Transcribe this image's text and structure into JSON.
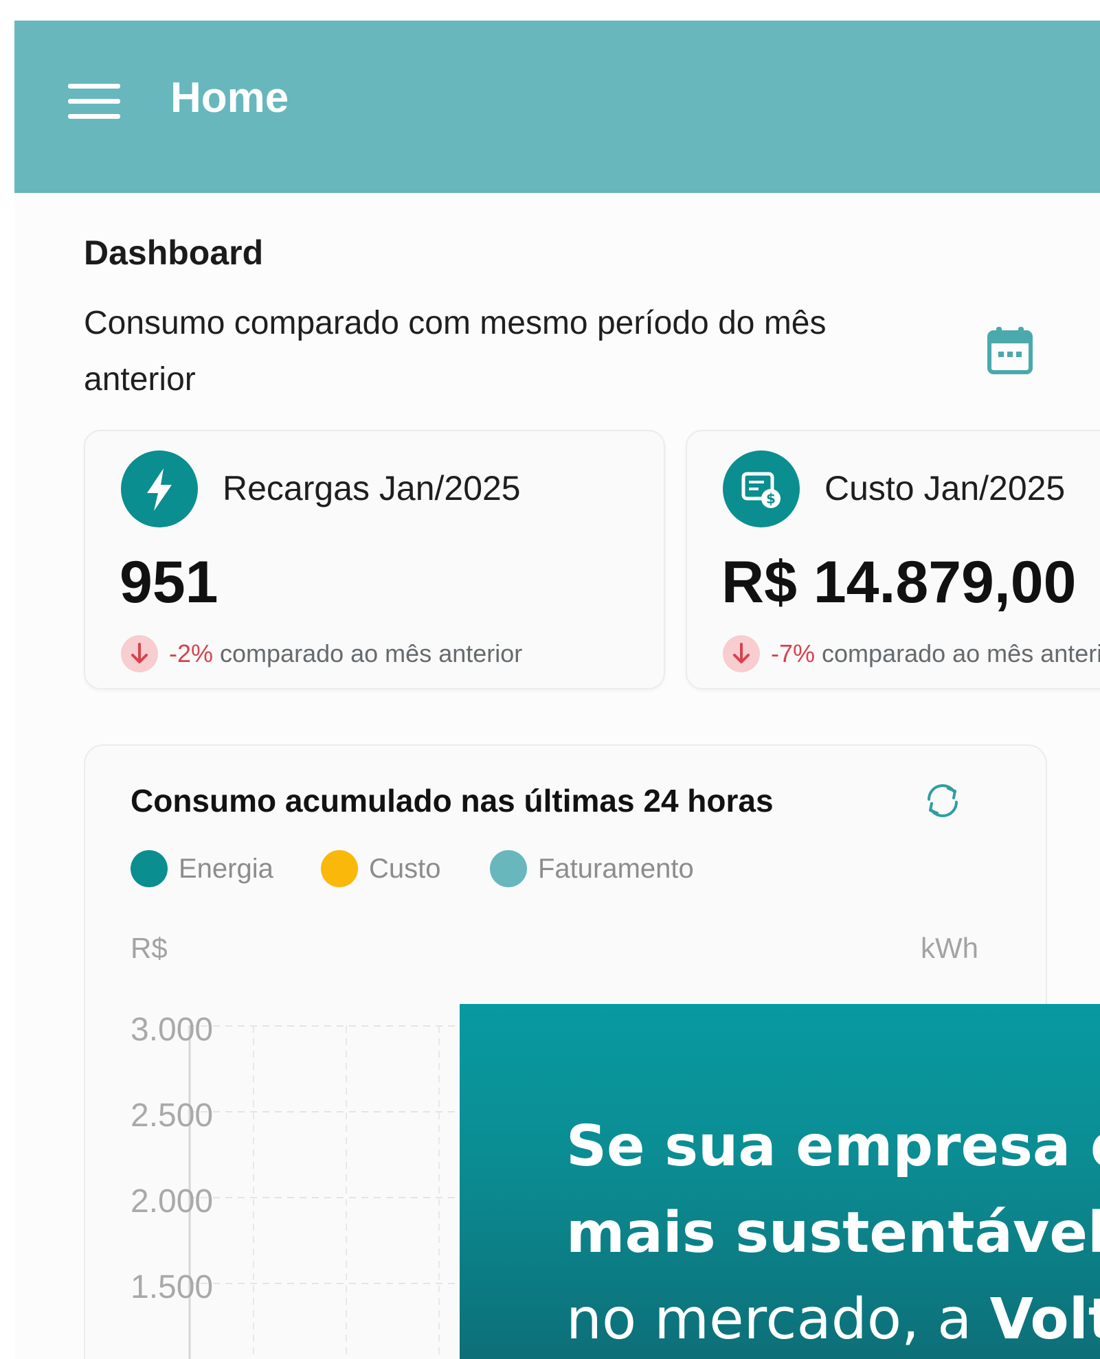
{
  "app_bar": {
    "title": "Home",
    "background_color": "#67b7bd",
    "menu_icon": "hamburger-menu-icon"
  },
  "dashboard": {
    "title": "Dashboard",
    "subtitle": "Consumo comparado com mesmo período do mês anterior",
    "calendar_icon": "calendar-icon"
  },
  "stat_cards": [
    {
      "icon": "lightning-bolt-icon",
      "label": "Recargas Jan/2025",
      "value": "951",
      "trend_pct": "-2%",
      "trend_text": " comparado ao mês anterior",
      "trend_icon": "arrow-down-icon"
    },
    {
      "icon": "invoice-dollar-icon",
      "label": "Custo Jan/2025",
      "value": "R$ 14.879,00",
      "trend_pct": "-7%",
      "trend_text": " comparado ao mês anterior",
      "trend_icon": "arrow-down-icon"
    }
  ],
  "chart_card": {
    "title": "Consumo acumulado nas últimas 24 horas",
    "refresh_icon": "refresh-icon",
    "legend": [
      {
        "label": "Energia",
        "color": "#0b8e8f"
      },
      {
        "label": "Custo",
        "color": "#f9b80a"
      },
      {
        "label": "Faturamento",
        "color": "#67b7bd"
      }
    ],
    "left_axis_unit": "R$",
    "right_axis_unit": "kWh",
    "y_ticks": [
      "3.000",
      "2.500",
      "2.000",
      "1.500"
    ]
  },
  "chart_data": {
    "type": "line",
    "title": "Consumo acumulado nas últimas 24 horas",
    "series": [
      {
        "name": "Energia",
        "values": []
      },
      {
        "name": "Custo",
        "values": []
      },
      {
        "name": "Faturamento",
        "values": []
      }
    ],
    "ylabel": "R$",
    "y2label": "kWh",
    "y_ticks": [
      3000,
      2500,
      2000,
      1500
    ],
    "grid": true,
    "legend_position": "top-left"
  },
  "banner": {
    "line1": "Se sua empresa d",
    "line2": "mais sustentável",
    "line3_prefix": "no mercado, a ",
    "line3_brand": "Volt",
    "colors": {
      "top": "#089aa1",
      "bottom": "#0d6f78"
    }
  }
}
